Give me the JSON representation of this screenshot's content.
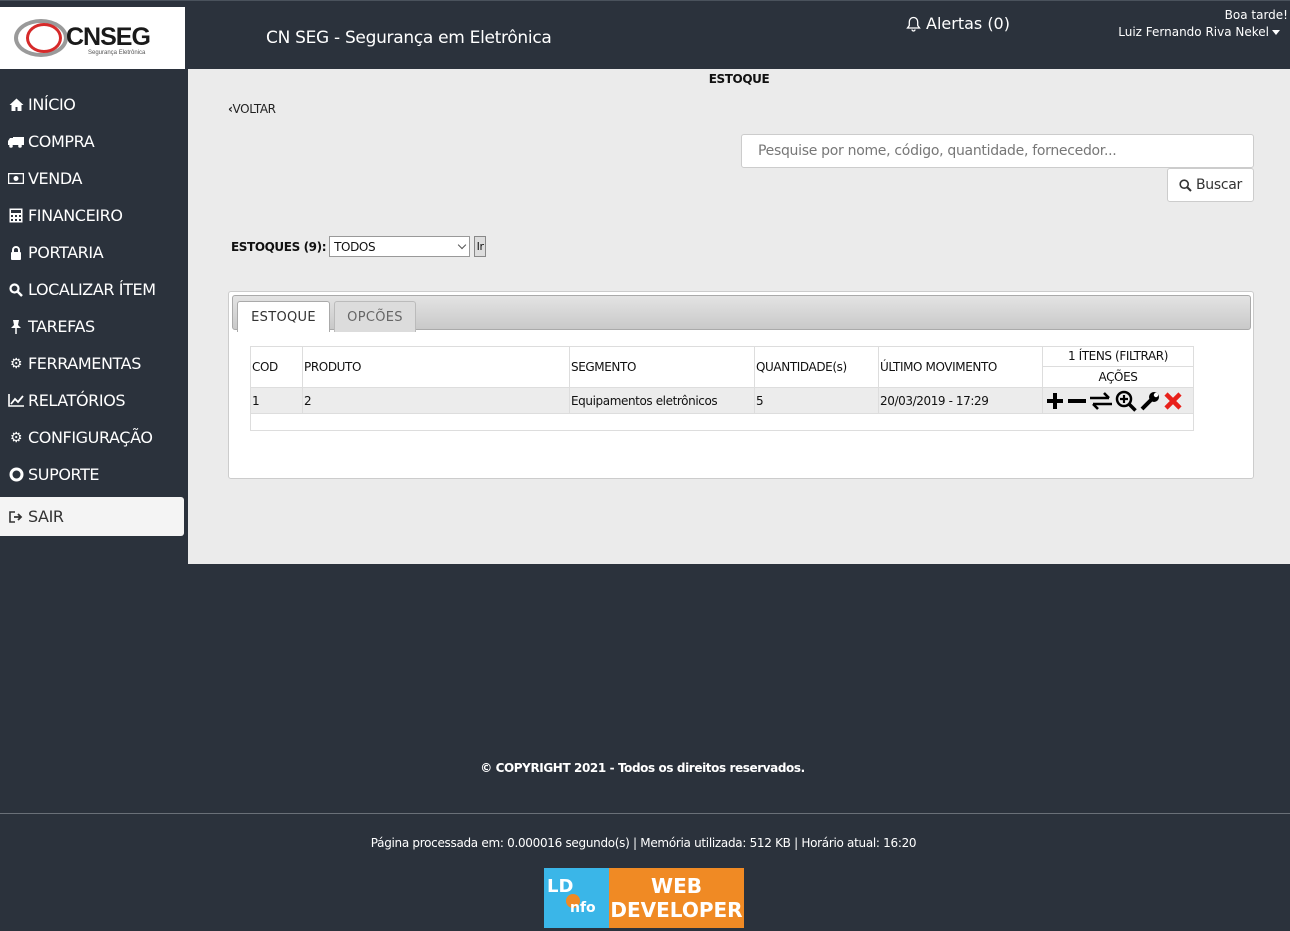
{
  "header": {
    "logo_text": "CNSEG",
    "logo_sub": "Segurança Eletrônica",
    "app_title": "CN SEG - Segurança em Eletrônica",
    "alerts_label": "Alertas (0)",
    "greeting": "Boa tarde!",
    "user_name": "Luiz Fernando Riva Nekel"
  },
  "sidebar": {
    "items": [
      {
        "label": "INÍCIO",
        "icon": "home-icon"
      },
      {
        "label": "COMPRA",
        "icon": "truck-icon"
      },
      {
        "label": "VENDA",
        "icon": "money-icon"
      },
      {
        "label": "FINANCEIRO",
        "icon": "calculator-icon"
      },
      {
        "label": "PORTARIA",
        "icon": "lock-icon"
      },
      {
        "label": "LOCALIZAR ÍTEM",
        "icon": "search-icon"
      },
      {
        "label": "TAREFAS",
        "icon": "pin-icon"
      },
      {
        "label": "FERRAMENTAS",
        "icon": "gear-icon"
      },
      {
        "label": "RELATÓRIOS",
        "icon": "chart-icon"
      },
      {
        "label": "CONFIGURAÇÃO",
        "icon": "gears-icon"
      },
      {
        "label": "SUPORTE",
        "icon": "lifebuoy-icon"
      },
      {
        "label": "SAIR",
        "icon": "sign-out-icon"
      }
    ]
  },
  "main": {
    "title": "ESTOQUE",
    "back_label": "VOLTAR",
    "search": {
      "placeholder": "Pesquise por nome, código, quantidade, fornecedor...",
      "button_label": "Buscar"
    },
    "filter": {
      "label": "ESTOQUES (9):",
      "selected": "TODOS",
      "go_label": "Ir"
    },
    "tabs": [
      {
        "label": "ESTOQUE",
        "active": true
      },
      {
        "label": "OPCÕES",
        "active": false
      }
    ],
    "table": {
      "columns": [
        "COD",
        "PRODUTO",
        "SEGMENTO",
        "QUANTIDADE(s)",
        "ÚLTIMO MOVIMENTO"
      ],
      "items_count": "1  ÍTENS (FILTRAR)",
      "actions_label": "AÇÕES",
      "rows": [
        {
          "cod": "1",
          "produto": "2",
          "segmento": "Equipamentos eletrônicos",
          "quantidade": "5",
          "ultimo": "20/03/2019 - 17:29"
        }
      ],
      "action_icons": [
        "plus-icon",
        "minus-icon",
        "transfer-icon",
        "zoom-in-icon",
        "wrench-icon",
        "delete-icon"
      ],
      "delete_color": "#e8201a"
    }
  },
  "footer": {
    "copyright": "© COPYRIGHT 2021 - Todos os direitos reservados.",
    "processed": "Página processada em: 0.000016 segundo(s) | Memória utilizada: 512 KB | Horário atual: 16:20",
    "badge_left": "LD",
    "badge_left_sub": "nfo",
    "badge_right_1": "WEB",
    "badge_right_2": "DEVELOPER"
  },
  "colors": {
    "background": "#2b323c",
    "content": "#ebebeb",
    "logo_red": "#d62a2a",
    "badge_blue": "#3ab6e8",
    "badge_orange": "#f08a24"
  }
}
